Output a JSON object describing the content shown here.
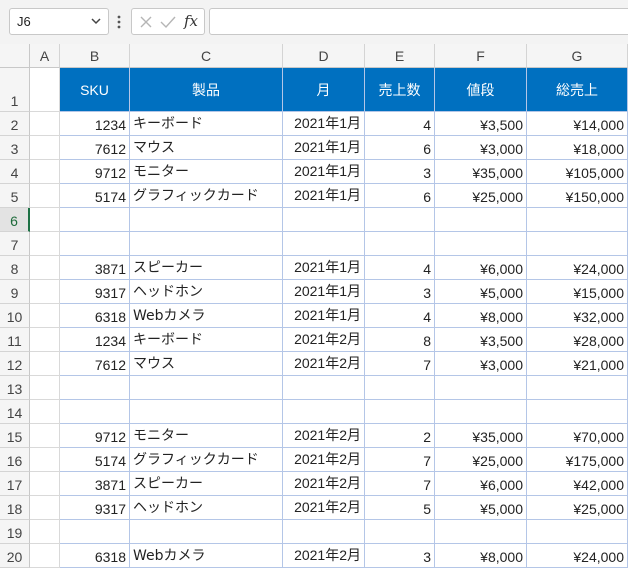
{
  "formula_bar": {
    "name_box": "J6",
    "fx_label": "fx",
    "formula": ""
  },
  "columns": [
    "A",
    "B",
    "C",
    "D",
    "E",
    "F",
    "G"
  ],
  "table_header": {
    "B": "SKU",
    "C": "製品",
    "D": "月",
    "E": "売上数",
    "F": "値段",
    "G": "総売上"
  },
  "rows": [
    {
      "num": "1"
    },
    {
      "num": "2",
      "cells": [
        "1234",
        "キーボード",
        "2021年1月",
        "4",
        "¥3,500",
        "¥14,000"
      ]
    },
    {
      "num": "3",
      "cells": [
        "7612",
        "マウス",
        "2021年1月",
        "6",
        "¥3,000",
        "¥18,000"
      ]
    },
    {
      "num": "4",
      "cells": [
        "9712",
        "モニター",
        "2021年1月",
        "3",
        "¥35,000",
        "¥105,000"
      ]
    },
    {
      "num": "5",
      "cells": [
        "5174",
        "グラフィックカード",
        "2021年1月",
        "6",
        "¥25,000",
        "¥150,000"
      ]
    },
    {
      "num": "6",
      "cells": [
        "",
        "",
        "",
        "",
        "",
        ""
      ]
    },
    {
      "num": "7",
      "cells": [
        "",
        "",
        "",
        "",
        "",
        ""
      ]
    },
    {
      "num": "8",
      "cells": [
        "3871",
        "スピーカー",
        "2021年1月",
        "4",
        "¥6,000",
        "¥24,000"
      ]
    },
    {
      "num": "9",
      "cells": [
        "9317",
        "ヘッドホン",
        "2021年1月",
        "3",
        "¥5,000",
        "¥15,000"
      ]
    },
    {
      "num": "10",
      "cells": [
        "6318",
        "Webカメラ",
        "2021年1月",
        "4",
        "¥8,000",
        "¥32,000"
      ]
    },
    {
      "num": "11",
      "cells": [
        "1234",
        "キーボード",
        "2021年2月",
        "8",
        "¥3,500",
        "¥28,000"
      ]
    },
    {
      "num": "12",
      "cells": [
        "7612",
        "マウス",
        "2021年2月",
        "7",
        "¥3,000",
        "¥21,000"
      ]
    },
    {
      "num": "13",
      "cells": [
        "",
        "",
        "",
        "",
        "",
        ""
      ]
    },
    {
      "num": "14",
      "cells": [
        "",
        "",
        "",
        "",
        "",
        ""
      ]
    },
    {
      "num": "15",
      "cells": [
        "9712",
        "モニター",
        "2021年2月",
        "2",
        "¥35,000",
        "¥70,000"
      ]
    },
    {
      "num": "16",
      "cells": [
        "5174",
        "グラフィックカード",
        "2021年2月",
        "7",
        "¥25,000",
        "¥175,000"
      ]
    },
    {
      "num": "17",
      "cells": [
        "3871",
        "スピーカー",
        "2021年2月",
        "7",
        "¥6,000",
        "¥42,000"
      ]
    },
    {
      "num": "18",
      "cells": [
        "9317",
        "ヘッドホン",
        "2021年2月",
        "5",
        "¥5,000",
        "¥25,000"
      ]
    },
    {
      "num": "19",
      "cells": [
        "",
        "",
        "",
        "",
        "",
        ""
      ]
    },
    {
      "num": "20",
      "cells": [
        "6318",
        "Webカメラ",
        "2021年2月",
        "3",
        "¥8,000",
        "¥24,000"
      ]
    }
  ],
  "active_row": "6",
  "colors": {
    "header_fill": "#0070c0",
    "header_text": "#ffffff",
    "selection": "#1e7145",
    "gridline": "#b4c6e7"
  }
}
